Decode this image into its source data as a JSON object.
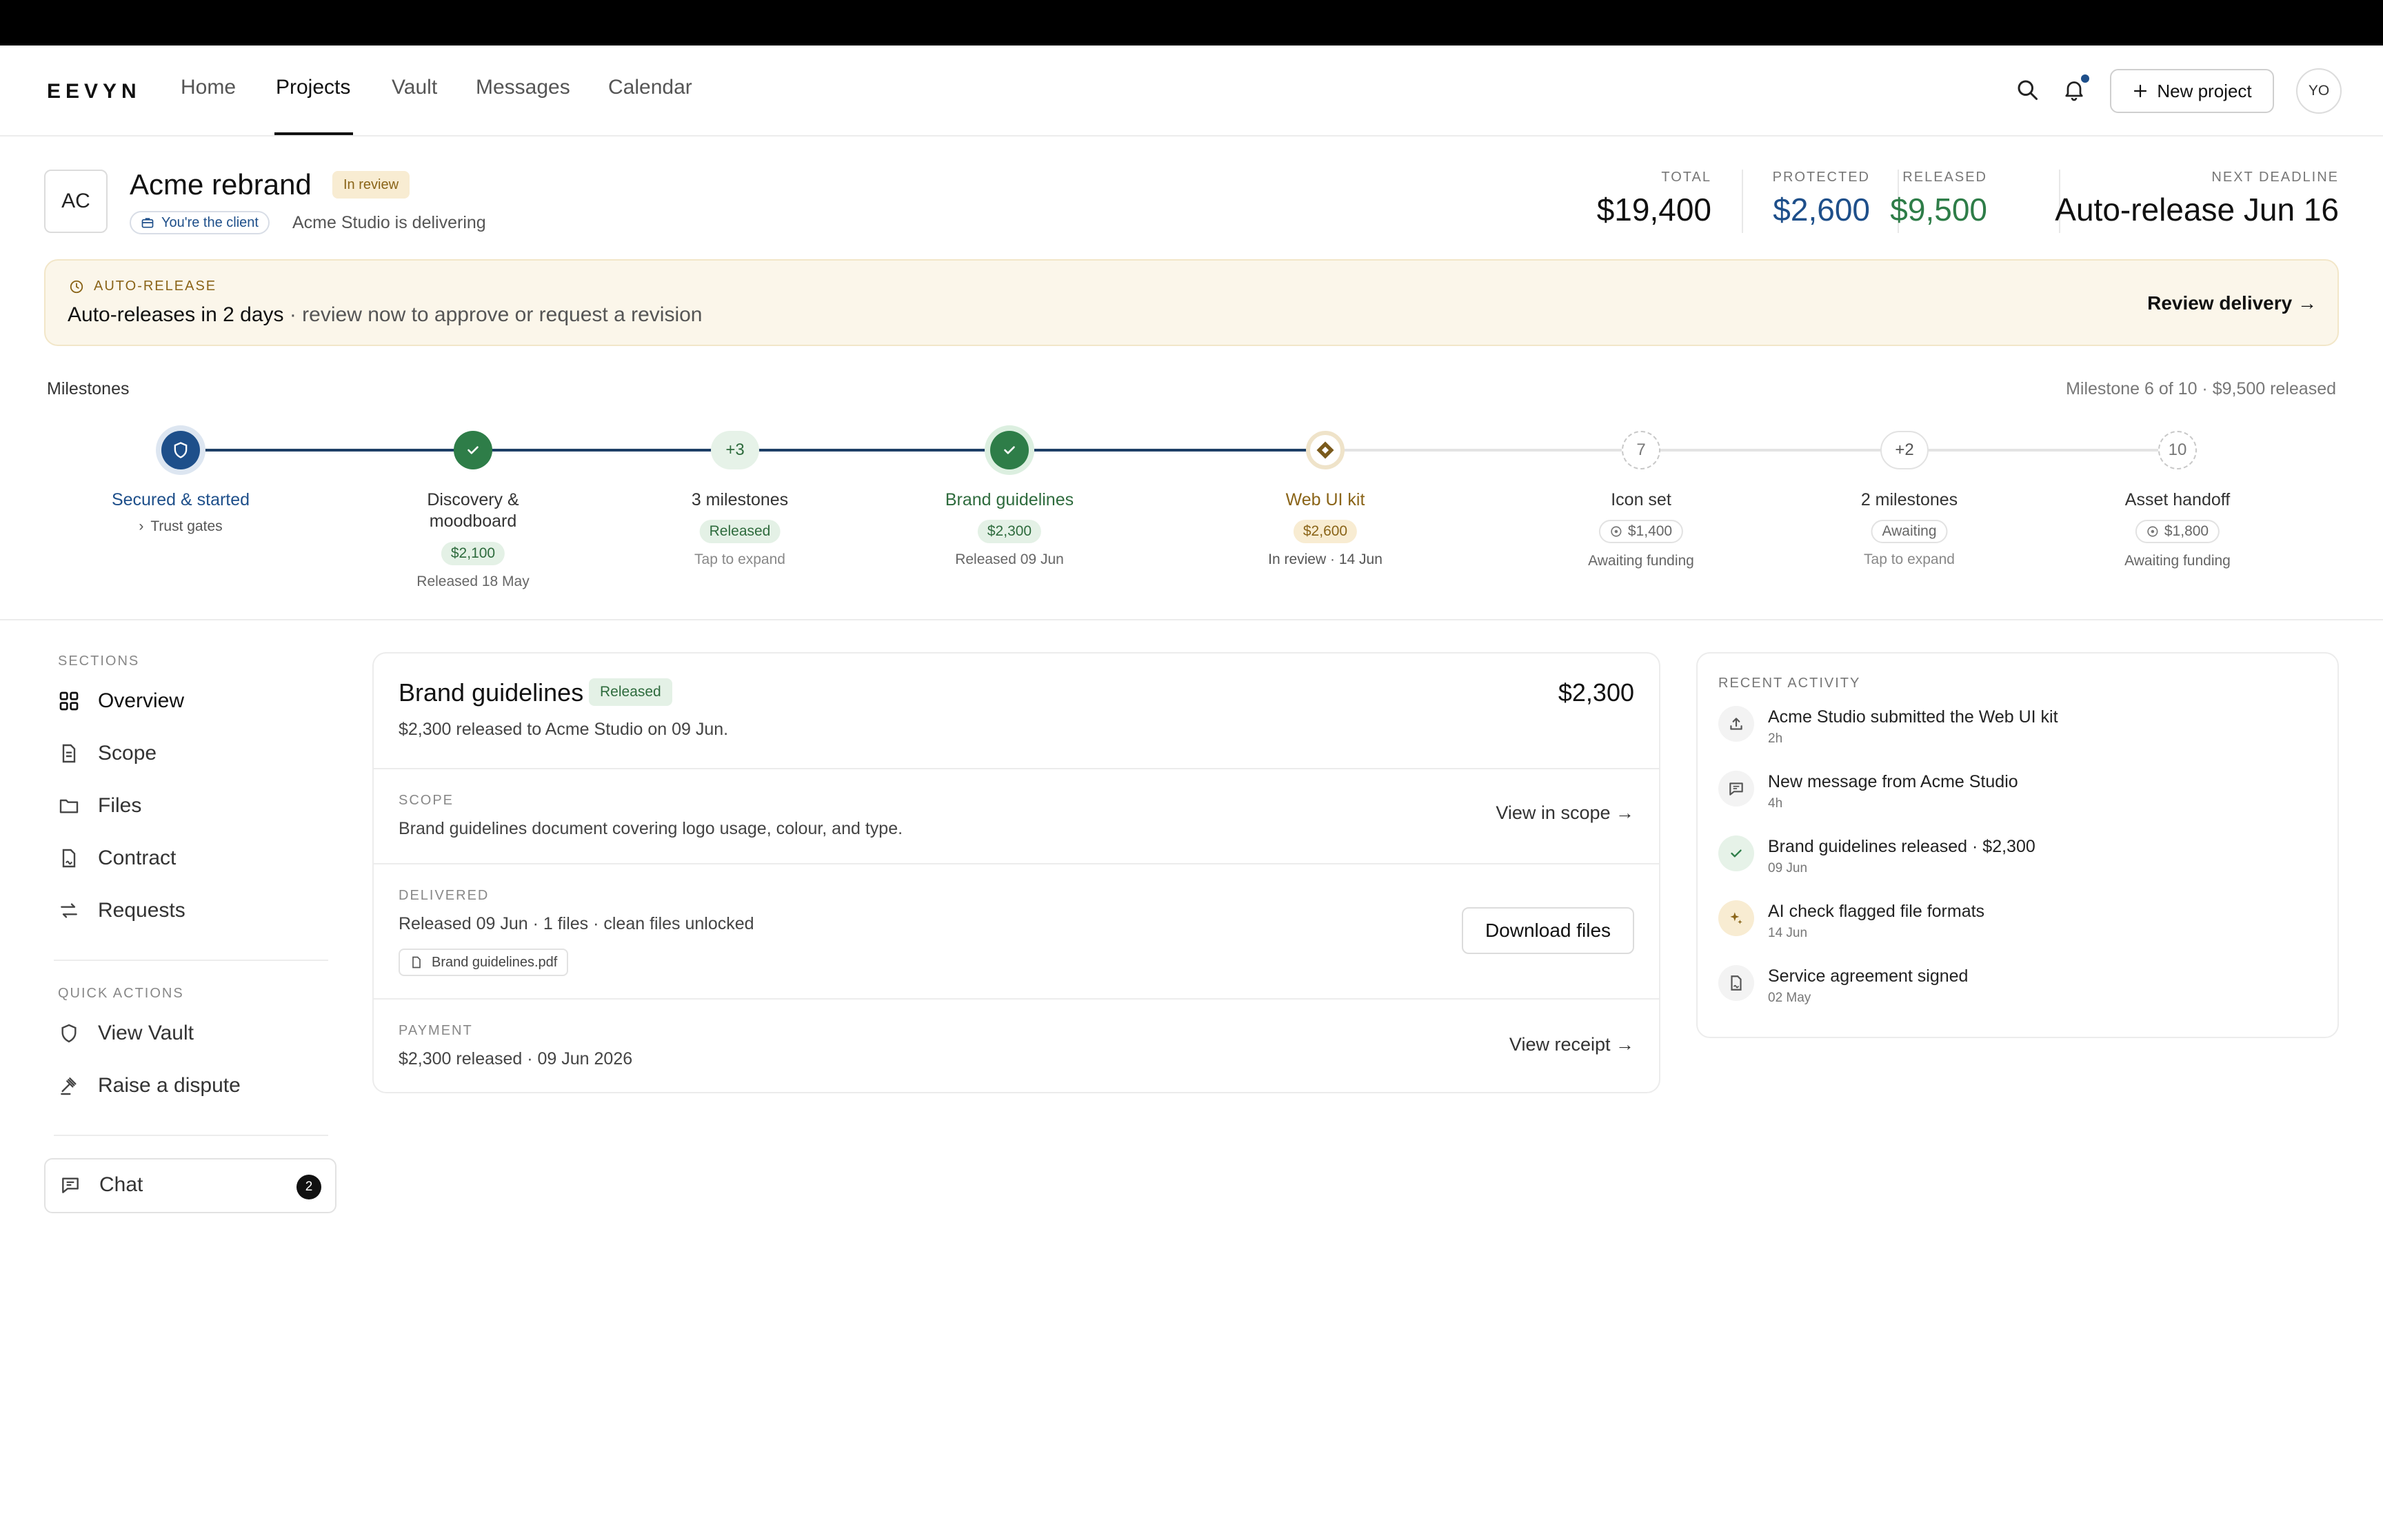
{
  "nav": {
    "logo": "EEVYN",
    "links": [
      "Home",
      "Projects",
      "Vault",
      "Messages",
      "Calendar"
    ],
    "new_project_label": "New project",
    "avatar_initials": "YO"
  },
  "project": {
    "initials": "AC",
    "title": "Acme rebrand",
    "status": "In review",
    "client_pill": "You're the client",
    "delivering": "Acme Studio is delivering"
  },
  "stats": {
    "total": {
      "label": "TOTAL",
      "value": "$19,400"
    },
    "protected": {
      "label": "PROTECTED",
      "value": "$2,600"
    },
    "released": {
      "label": "RELEASED",
      "value": "$9,500"
    },
    "deadline": {
      "label": "NEXT DEADLINE",
      "value": "Auto-release Jun 16"
    }
  },
  "colors": {
    "accent_blue": "#1e4f8a",
    "released_green": "#2e7d48",
    "review_gold": "#8a6418"
  },
  "banner": {
    "kicker": "AUTO-RELEASE",
    "bold": "Auto-releases in 2 days",
    "rest": " · review now to approve or request a revision",
    "cta": "Review delivery →"
  },
  "milestones": {
    "title": "Milestones",
    "summary": "Milestone 6 of 10 · $9,500 released",
    "items": [
      {
        "node": "",
        "label": "Secured & started",
        "chip": "",
        "sub": "Trust gates"
      },
      {
        "node": "",
        "label": "Discovery & moodboard",
        "chip": "$2,100",
        "sub": "Released 18 May"
      },
      {
        "node": "+3",
        "label": "3 milestones",
        "chip": "Released",
        "sub": "Tap to expand"
      },
      {
        "node": "",
        "label": "Brand guidelines",
        "chip": "$2,300",
        "sub": "Released 09 Jun"
      },
      {
        "node": "",
        "label": "Web UI kit",
        "chip": "$2,600",
        "sub": "In review · 14 Jun"
      },
      {
        "node": "7",
        "label": "Icon set",
        "chip": "$1,400",
        "sub": "Awaiting funding"
      },
      {
        "node": "+2",
        "label": "2 milestones",
        "chip": "Awaiting",
        "sub": "Tap to expand"
      },
      {
        "node": "10",
        "label": "Asset handoff",
        "chip": "$1,800",
        "sub": "Awaiting funding"
      }
    ]
  },
  "sidebar": {
    "sections_title": "SECTIONS",
    "sections": [
      "Overview",
      "Scope",
      "Files",
      "Contract",
      "Requests"
    ],
    "quick_title": "QUICK ACTIONS",
    "quick": [
      "View Vault",
      "Raise a dispute"
    ],
    "chat_label": "Chat",
    "chat_count": "2"
  },
  "detail": {
    "title": "Brand guidelines",
    "badge": "Released",
    "amount": "$2,300",
    "subtitle": "$2,300 released to Acme Studio on 09 Jun.",
    "scope": {
      "kicker": "SCOPE",
      "text": "Brand guidelines document covering logo usage, colour, and type.",
      "link": "View in scope →"
    },
    "delivered": {
      "kicker": "DELIVERED",
      "text": "Released 09 Jun · 1 files · clean files unlocked",
      "file": "Brand guidelines.pdf",
      "button": "Download files"
    },
    "payment": {
      "kicker": "PAYMENT",
      "text": "$2,300 released · 09 Jun 2026",
      "link": "View receipt →"
    }
  },
  "activity": {
    "title": "RECENT ACTIVITY",
    "items": [
      {
        "icon": "upload-icon",
        "text": "Acme Studio submitted the Web UI kit",
        "time": "2h"
      },
      {
        "icon": "message-icon",
        "text": "New message from Acme Studio",
        "time": "4h"
      },
      {
        "icon": "check-icon",
        "text": "Brand guidelines released · $2,300",
        "time": "09 Jun"
      },
      {
        "icon": "sparkle-icon",
        "text": "AI check flagged file formats",
        "time": "14 Jun"
      },
      {
        "icon": "document-sign-icon",
        "text": "Service agreement signed",
        "time": "02 May"
      }
    ]
  }
}
